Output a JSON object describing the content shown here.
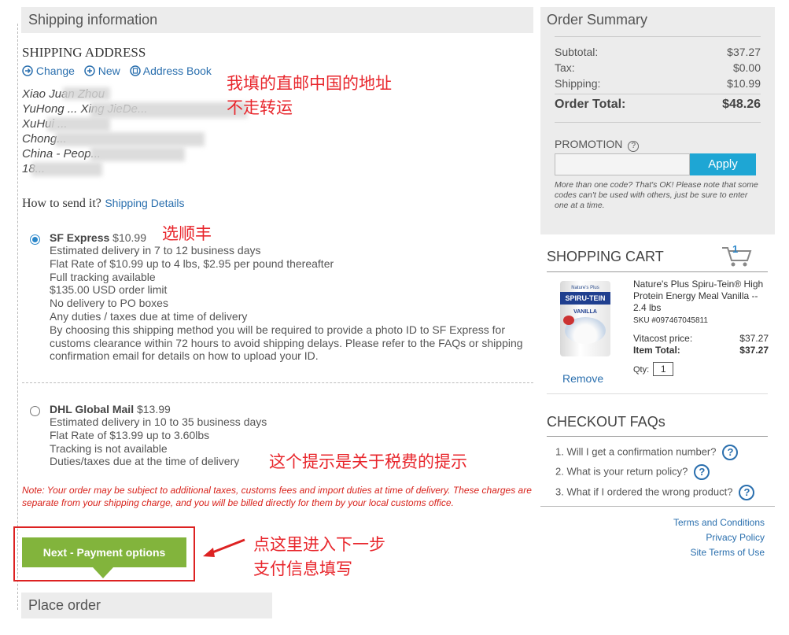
{
  "shipping_info": {
    "header": "Shipping information",
    "address_title": "SHIPPING ADDRESS",
    "actions": {
      "change": "Change",
      "new": "New",
      "address_book": "Address Book"
    },
    "address_lines": [
      "Xiao Juan Zhou",
      "YuHong ... Xing JieDe...",
      "XuHui ...",
      "Chong...",
      "China - Peop...",
      "18..."
    ],
    "how_to_send": "How to send it?",
    "shipping_details_link": "Shipping Details"
  },
  "annotations": {
    "address_note_1": "我填的直邮中国的地址",
    "address_note_2": "不走转运",
    "choose_sf": "选顺丰",
    "tax_note": "这个提示是关于税费的提示",
    "next_note_1": "点这里进入下一步",
    "next_note_2": "支付信息填写"
  },
  "shipping_options": [
    {
      "name": "SF Express",
      "price": "$10.99",
      "selected": true,
      "lines": [
        "Estimated delivery in 7 to 12 business days",
        "Flat Rate of $10.99 up to 4 lbs, $2.95 per pound thereafter",
        "Full tracking available",
        "$135.00 USD order limit",
        "No delivery to PO boxes",
        "Any duties / taxes due at time of delivery",
        "By choosing this shipping method you will be required to provide a photo ID to SF Express for",
        "customs clearance within 72 hours to avoid shipping delays. Please refer to the FAQs or shipping",
        "confirmation email for details on how to upload your ID."
      ]
    },
    {
      "name": "DHL Global Mail",
      "price": "$13.99",
      "selected": false,
      "lines": [
        "Estimated delivery in 10 to 35 business days",
        "Flat Rate of $13.99 up to 3.60lbs",
        "Tracking is not available",
        "Duties/taxes due at the time of delivery"
      ]
    }
  ],
  "note": "Note: Your order may be subject to additional taxes, customs fees and import duties at time of delivery. These charges are separate from your shipping charge, and you will be billed directly for them by your local customs office.",
  "next_button": "Next - Payment options",
  "place_order": "Place order",
  "order_summary": {
    "title": "Order Summary",
    "subtotal_label": "Subtotal:",
    "subtotal": "$37.27",
    "tax_label": "Tax:",
    "tax": "$0.00",
    "shipping_label": "Shipping:",
    "shipping": "$10.99",
    "total_label": "Order Total:",
    "total": "$48.26",
    "promotion_label": "PROMOTION",
    "apply": "Apply",
    "promo_note": "More than one code? That's OK! Please note that some codes can't be used with others, just be sure to enter one at a time."
  },
  "cart": {
    "title": "SHOPPING CART",
    "count": "1",
    "product_name": "Nature's Plus Spiru-Tein® High Protein Energy Meal Vanilla -- 2.4 lbs",
    "sku": "SKU #097467045811",
    "price_label": "Vitacost price:",
    "price": "$37.27",
    "total_label": "Item Total:",
    "total": "$37.27",
    "qty_label": "Qty:",
    "qty": "1",
    "remove": "Remove",
    "product_brand": "Nature's Plus",
    "product_logo": "SPIRU-TEIN",
    "product_flavor": "VANILLA"
  },
  "faqs": {
    "title": "CHECKOUT FAQs",
    "items": [
      "1. Will I get a confirmation number?",
      "2. What is your return policy?",
      "3. What if I ordered the wrong product?"
    ]
  },
  "footer": {
    "terms": "Terms and Conditions",
    "privacy": "Privacy Policy",
    "site_terms": "Site Terms of Use"
  },
  "colors": {
    "accent_green": "#82b43c",
    "apply_blue": "#1ea6d4",
    "annotation_red": "#e8262c",
    "link_blue": "#2a6fae"
  }
}
